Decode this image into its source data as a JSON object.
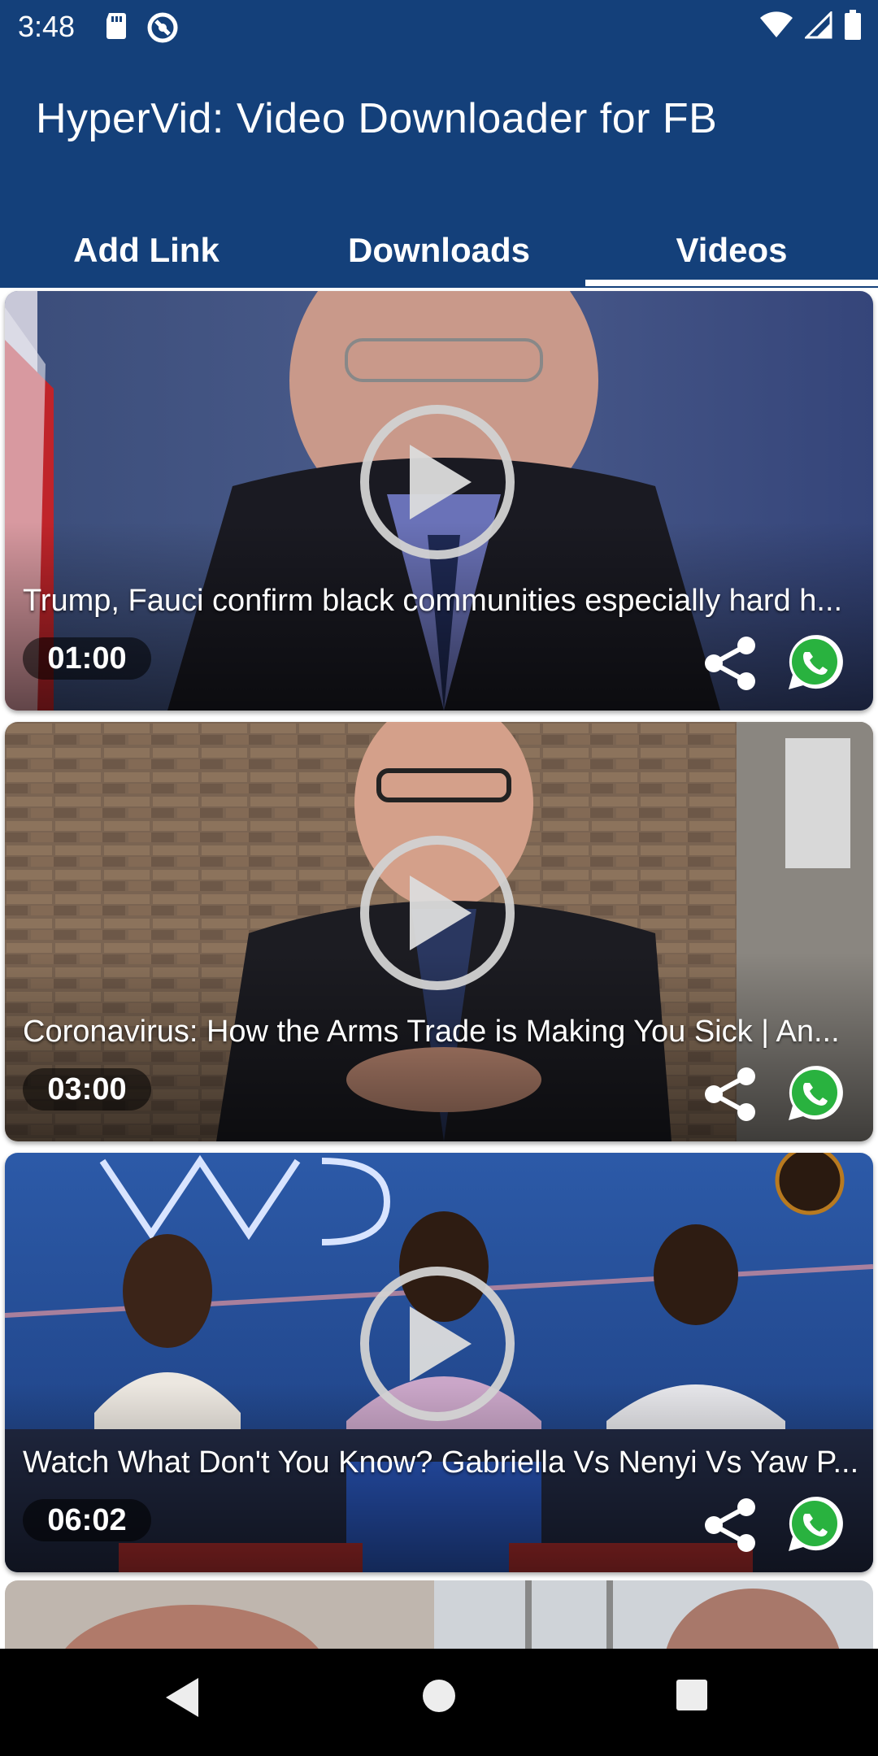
{
  "status_bar": {
    "time": "3:48",
    "left_icons": [
      "sd-card-icon",
      "circle-app-icon"
    ],
    "right_icons": [
      "wifi-icon",
      "cell-signal-icon",
      "battery-icon"
    ]
  },
  "app": {
    "title": "HyperVid: Video Downloader for FB",
    "primary_color": "#14407a"
  },
  "tabs": [
    {
      "label": "Add Link",
      "selected": false
    },
    {
      "label": "Downloads",
      "selected": false
    },
    {
      "label": "Videos",
      "selected": true
    }
  ],
  "videos": [
    {
      "title": "Trump, Fauci confirm black communities especially hard h...",
      "duration": "01:00"
    },
    {
      "title": "Coronavirus: How the Arms Trade is Making You Sick | An...",
      "duration": "03:00"
    },
    {
      "title": "Watch What Don't You Know? Gabriella Vs Nenyi Vs Yaw P...",
      "duration": "06:02"
    }
  ],
  "nav": {
    "icons": [
      "back-icon",
      "home-icon",
      "recents-icon"
    ]
  }
}
